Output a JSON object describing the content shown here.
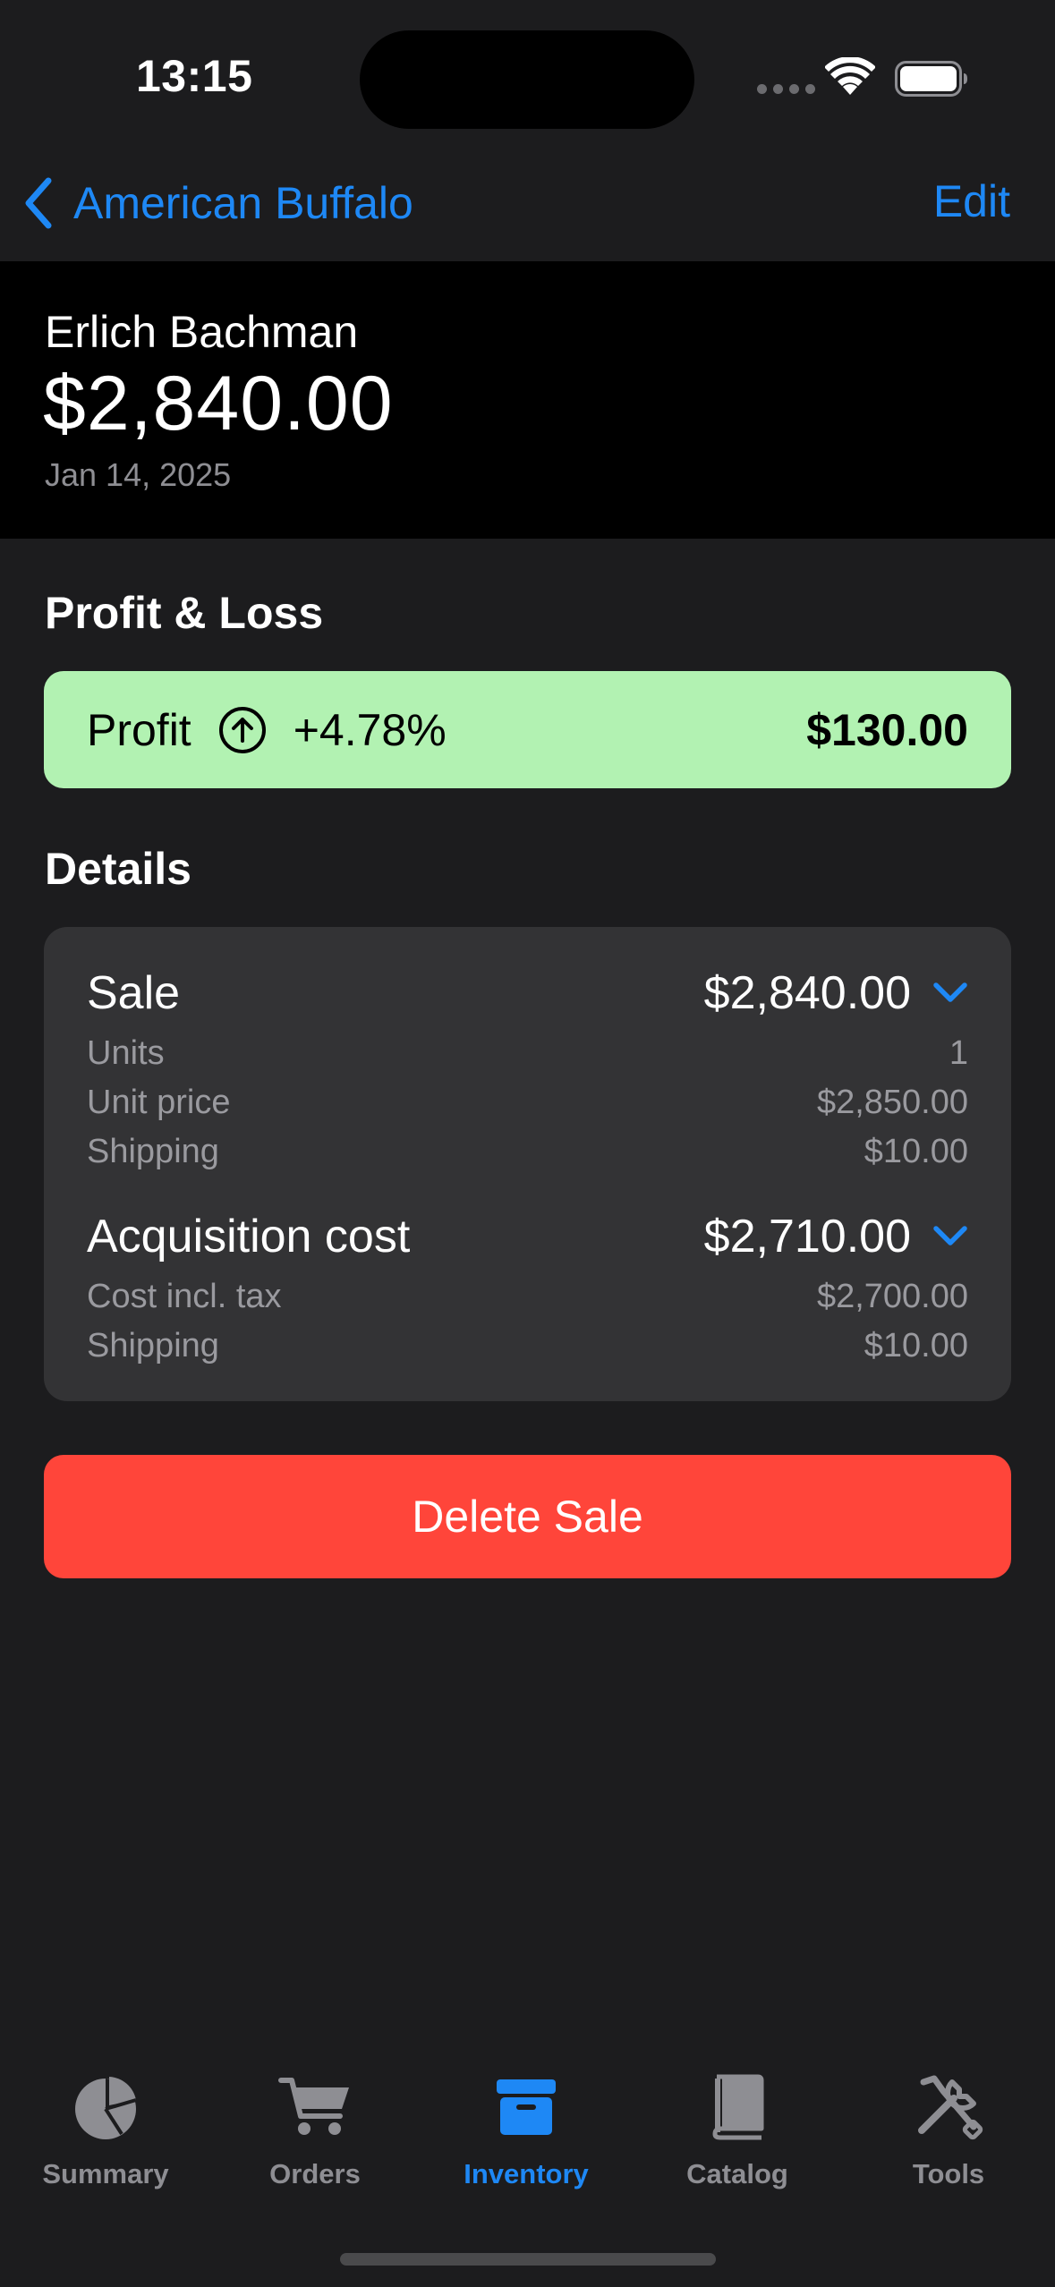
{
  "status_bar": {
    "time": "13:15"
  },
  "nav": {
    "back_label": "American Buffalo",
    "edit_label": "Edit"
  },
  "header": {
    "customer": "Erlich Bachman",
    "amount": "$2,840.00",
    "date": "Jan 14, 2025"
  },
  "profit_loss": {
    "title": "Profit & Loss",
    "label": "Profit",
    "percent": "+4.78%",
    "amount": "$130.00",
    "color": "#b2f2b2"
  },
  "details": {
    "title": "Details",
    "sale": {
      "label": "Sale",
      "value": "$2,840.00",
      "rows": [
        {
          "label": "Units",
          "value": "1"
        },
        {
          "label": "Unit price",
          "value": "$2,850.00"
        },
        {
          "label": "Shipping",
          "value": "$10.00"
        }
      ]
    },
    "acquisition": {
      "label": "Acquisition cost",
      "value": "$2,710.00",
      "rows": [
        {
          "label": "Cost incl. tax",
          "value": "$2,700.00"
        },
        {
          "label": "Shipping",
          "value": "$10.00"
        }
      ]
    }
  },
  "delete_button": {
    "label": "Delete Sale",
    "color": "#ff453a"
  },
  "tabs": [
    {
      "label": "Summary",
      "icon": "pie-chart-icon",
      "active": false
    },
    {
      "label": "Orders",
      "icon": "cart-icon",
      "active": false
    },
    {
      "label": "Inventory",
      "icon": "archive-box-icon",
      "active": true
    },
    {
      "label": "Catalog",
      "icon": "book-icon",
      "active": false
    },
    {
      "label": "Tools",
      "icon": "tools-icon",
      "active": false
    }
  ],
  "colors": {
    "accent": "#1e88f5",
    "background": "#1c1c1e"
  }
}
